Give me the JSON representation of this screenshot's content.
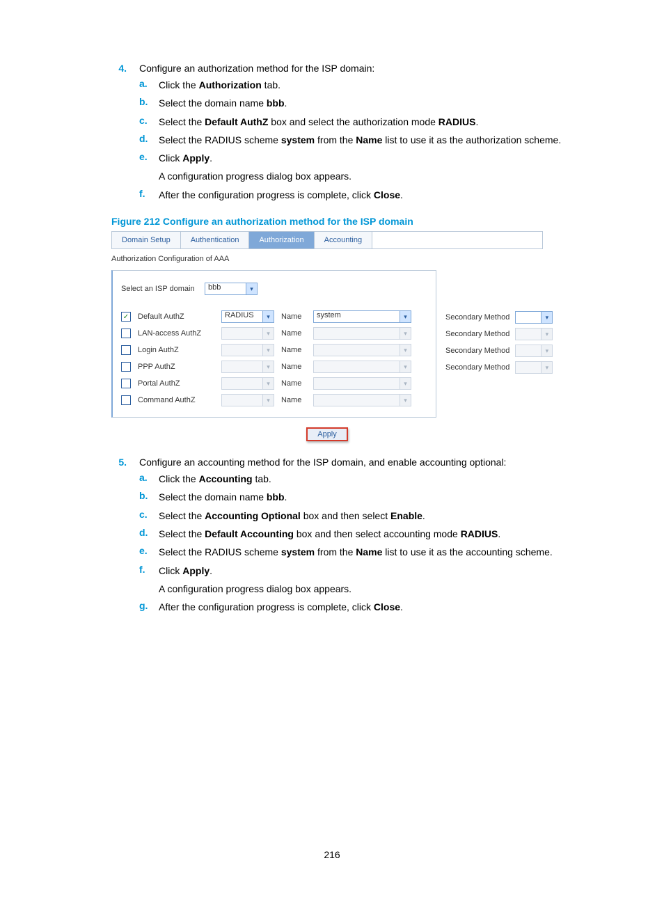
{
  "step4": {
    "marker": "4.",
    "intro": "Configure an authorization method for the ISP domain:",
    "a": {
      "m": "a.",
      "pre": "Click the ",
      "bold": "Authorization",
      "post": " tab."
    },
    "b": {
      "m": "b.",
      "pre": "Select the domain name ",
      "bold": "bbb",
      "post": "."
    },
    "c": {
      "m": "c.",
      "pre": "Select the ",
      "b1": "Default AuthZ",
      "mid": " box and select the authorization mode ",
      "b2": "RADIUS",
      "post": "."
    },
    "d": {
      "m": "d.",
      "pre": "Select the RADIUS scheme ",
      "b1": "system",
      "mid": " from the ",
      "b2": "Name",
      "post": " list to use it as the authorization scheme."
    },
    "e": {
      "m": "e.",
      "pre": "Click ",
      "bold": "Apply",
      "post": "."
    },
    "e_sub": "A configuration progress dialog box appears.",
    "f": {
      "m": "f.",
      "pre": "After the configuration progress is complete, click ",
      "bold": "Close",
      "post": "."
    }
  },
  "figure_caption": "Figure 212 Configure an authorization method for the ISP domain",
  "shot": {
    "tabs": [
      "Domain Setup",
      "Authentication",
      "Authorization",
      "Accounting"
    ],
    "subtitle": "Authorization Configuration of AAA",
    "select_label": "Select an ISP domain",
    "domain_value": "bbb",
    "rows": [
      {
        "label": "Default AuthZ",
        "checked": true,
        "mode": "RADIUS",
        "name": "system",
        "side": true,
        "enabled": true
      },
      {
        "label": "LAN-access AuthZ",
        "checked": false,
        "mode": "",
        "name": "",
        "side": true,
        "enabled": false
      },
      {
        "label": "Login AuthZ",
        "checked": false,
        "mode": "",
        "name": "",
        "side": true,
        "enabled": false
      },
      {
        "label": "PPP AuthZ",
        "checked": false,
        "mode": "",
        "name": "",
        "side": true,
        "enabled": false
      },
      {
        "label": "Portal AuthZ",
        "checked": false,
        "mode": "",
        "name": "",
        "side": false,
        "enabled": false
      },
      {
        "label": "Command AuthZ",
        "checked": false,
        "mode": "",
        "name": "",
        "side": false,
        "enabled": false
      }
    ],
    "name_label": "Name",
    "secondary_label": "Secondary Method",
    "apply": "Apply"
  },
  "step5": {
    "marker": "5.",
    "intro": "Configure an accounting method for the ISP domain, and enable accounting optional:",
    "a": {
      "m": "a.",
      "pre": "Click the ",
      "bold": "Accounting",
      "post": " tab."
    },
    "b": {
      "m": "b.",
      "pre": "Select the domain name ",
      "bold": "bbb",
      "post": "."
    },
    "c": {
      "m": "c.",
      "pre": "Select the ",
      "b1": "Accounting Optional",
      "mid": " box and then select ",
      "b2": "Enable",
      "post": "."
    },
    "d": {
      "m": "d.",
      "pre": "Select the ",
      "b1": "Default Accounting",
      "mid": " box and then select accounting mode ",
      "b2": "RADIUS",
      "post": "."
    },
    "e": {
      "m": "e.",
      "pre": "Select the RADIUS scheme ",
      "b1": "system",
      "mid": " from the ",
      "b2": "Name",
      "post": " list to use it as the accounting scheme."
    },
    "f": {
      "m": "f.",
      "pre": "Click ",
      "bold": "Apply",
      "post": "."
    },
    "f_sub": "A configuration progress dialog box appears.",
    "g": {
      "m": "g.",
      "pre": "After the configuration progress is complete, click ",
      "bold": "Close",
      "post": "."
    }
  },
  "page_number": "216"
}
